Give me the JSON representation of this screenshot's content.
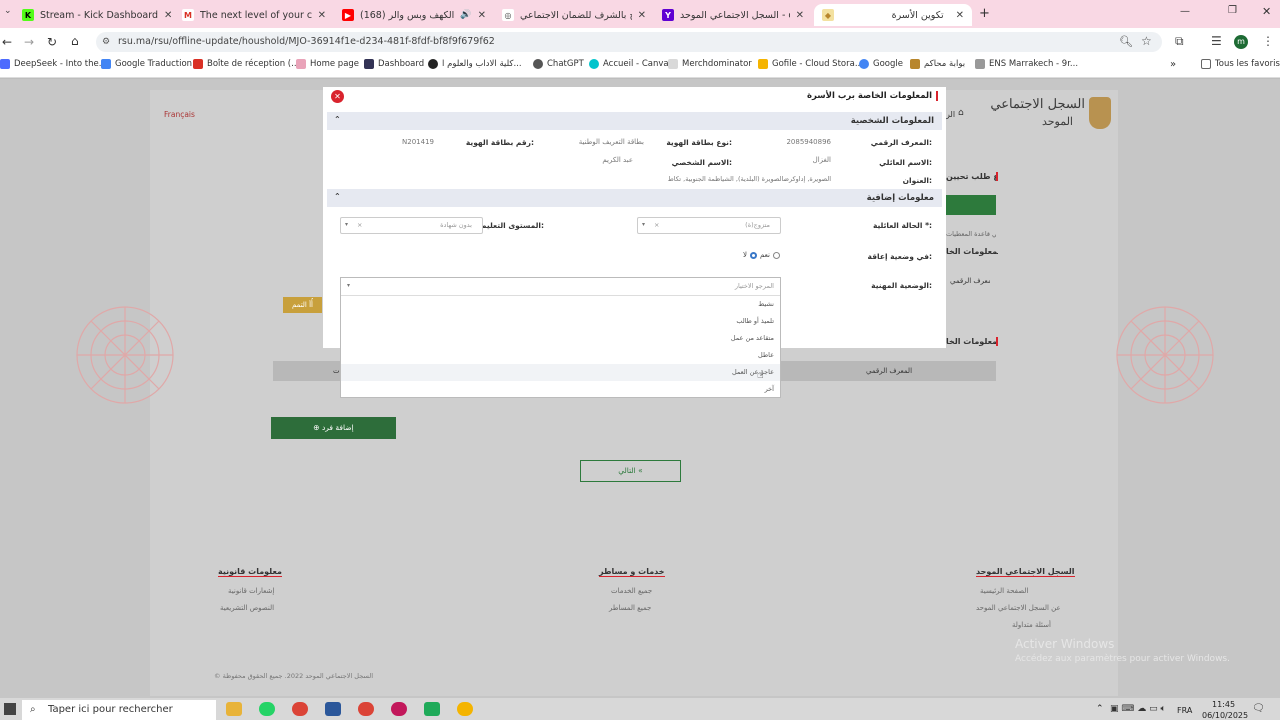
{
  "browser": {
    "tabs": [
      {
        "title": "Stream - Kick Dashboard",
        "color": "#53fc18",
        "glyph": "K"
      },
      {
        "title": "The next level of your creator jo",
        "color": "#d93025",
        "glyph": "M"
      },
      {
        "title": "(168) سورة الكهف وبس والر",
        "color": "#ff0000",
        "glyph": "▶"
      },
      {
        "title": "تصريح بالشرف للضمان الاجتماعي",
        "color": "#444444",
        "glyph": "◎"
      },
      {
        "title": "السجل الاجتماعي الموحد - orche",
        "color": "#6001d2",
        "glyph": "Y"
      },
      {
        "title": "تكوين الأسرة",
        "color": "#c8a03c",
        "glyph": "◆"
      }
    ],
    "url": "rsu.ma/rsu/offline-update/houshold/MJO-36914f1e-d234-481f-8fdf-bf8f9f679f62",
    "bookmarks": [
      "DeepSeek - Into the...",
      "Google Traduction",
      "Boîte de réception (...",
      "Home page",
      "Dashboard",
      "كلية الاداب والعلوم ا...",
      "ChatGPT",
      "Accueil - Canva",
      "Merchdominator",
      "Gofile - Cloud Stora...",
      "Google",
      "بوابة محاكم",
      "ENS Marrakech - 9r..."
    ],
    "all_bookmarks": "Tous les favoris"
  },
  "site": {
    "language_link": "Français",
    "logo_title_line1": "السجل الاجتماعي",
    "logo_title_line2": "الموحد",
    "home_label": "الر",
    "side_title_fragment": "إيداع طلب تحيين",
    "side_text_fragment": "في قاعدة المعطيات",
    "section_fragment_1": "المعلومات الخا",
    "section_fragment_2": "المعلومات الخا",
    "national_id_fragment": "المعرف الرقمي",
    "yellow_btn_label": "أُأ التمم",
    "table_header_numeric_id": "المعرف الرقمي",
    "table_header_fragment": "ت",
    "add_member_button": "إضافة فرد",
    "next_button": "التالي",
    "footer": {
      "col1_title": "السجل الاجتماعي الموحد",
      "col1_links": [
        "الصفحة الرئيسية",
        "عن السجل الاجتماعي الموحد",
        "أسئلة متداولة"
      ],
      "col2_title": "خدمات و مساطر",
      "col2_links": [
        "جميع الخدمات",
        "جميع المساطر"
      ],
      "col3_title": "معلومات قانونية",
      "col3_links": [
        "إشعارات قانونية",
        "النصوص التشريعية"
      ],
      "copyright": "© السجل الاجتماعي الموحد 2022. جميع الحقوق محفوظة"
    },
    "watermark_line1": "Activer Windows",
    "watermark_line2": "Accédez aux paramètres pour activer Windows."
  },
  "modal": {
    "title": "المعلومات الخاصة برب الأسرة",
    "personal_section": "المعلومات الشخصية",
    "fields": {
      "numeric_id_label": "المعرف الرقمي:",
      "numeric_id_value": "2085940896",
      "id_type_label": "نوع بطاقة الهوية:",
      "id_type_value": "بطاقة التعريف الوطنية",
      "id_number_label": "رقم بطاقة الهوية:",
      "id_number_value": "N201419",
      "family_name_label": "الاسم العائلي:",
      "family_name_value": "الغزال",
      "first_name_label": "الاسم الشخصي:",
      "first_name_value": "عبد الكريم",
      "address_label": "العنوان:",
      "address_value": "الصويرة, إداوكرضالصويرة (البلدية), الشياظمة الجنوبية, تكاط"
    },
    "additional_section": "معلومات إضافية",
    "marital_label": "الحالة العائلية *:",
    "marital_value": "متزوج(ة)",
    "education_label": "المستوى التعليمي:",
    "education_value": "بدون شهادة",
    "disability_label": "في وضعية إعاقة:",
    "disability_yes": "نعم",
    "disability_no": "لا",
    "professional_label": "الوضعية المهنية:",
    "professional_placeholder": "المرجو الاختيار",
    "options": [
      "نشيط",
      "تلميذ أو طالب",
      "متقاعد من عمل",
      "عاطل",
      "عاجز عن العمل",
      "آخر"
    ]
  },
  "taskbar": {
    "search_placeholder": "Taper ici pour rechercher",
    "lang": "FRA",
    "time": "11:45",
    "date": "06/10/2025"
  },
  "colors": {
    "accent_red": "#d9232d",
    "green_button": "#2d7a3c",
    "tab_strip": "#f9d8e4"
  }
}
